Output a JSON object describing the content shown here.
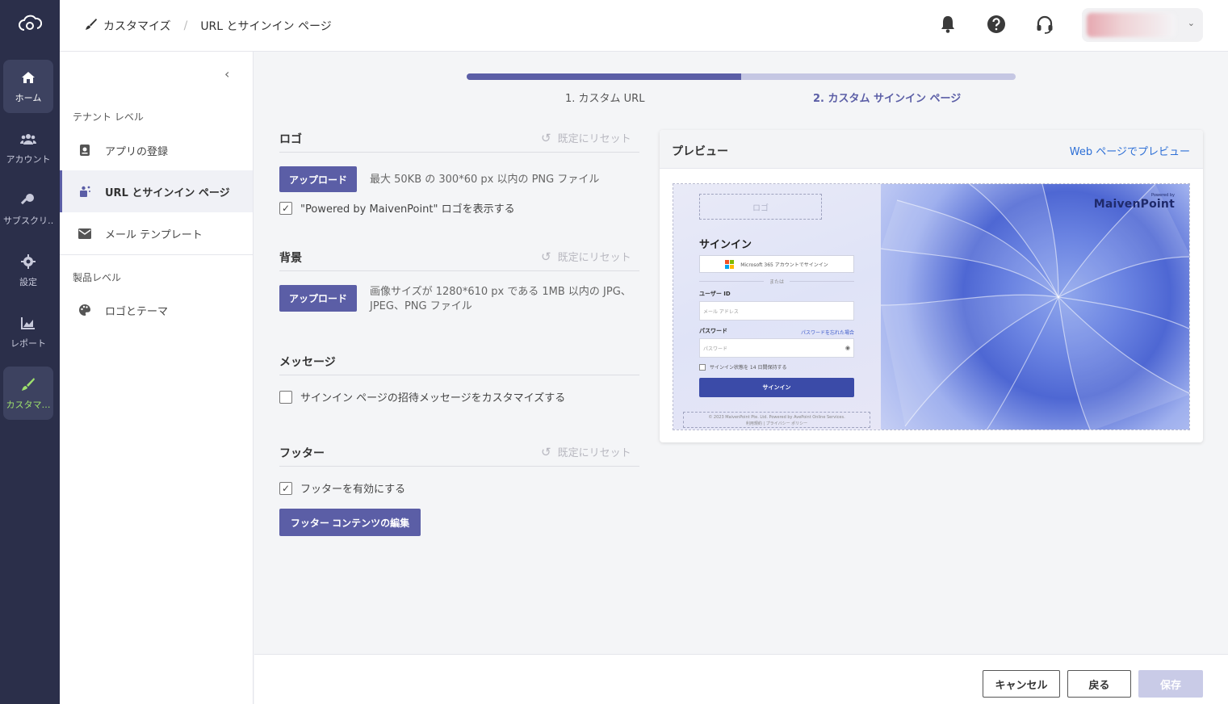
{
  "rail": {
    "items": [
      {
        "label": "ホーム",
        "icon": "home-icon"
      },
      {
        "label": "アカウント",
        "icon": "users-icon"
      },
      {
        "label": "サブスクリ…",
        "icon": "key-icon"
      },
      {
        "label": "設定",
        "icon": "gear-icon"
      },
      {
        "label": "レポート",
        "icon": "chart-icon"
      },
      {
        "label": "カスタマ…",
        "icon": "brush-icon"
      }
    ]
  },
  "header": {
    "breadcrumb_root": "カスタマイズ",
    "breadcrumb_sep": "/",
    "breadcrumb_current": "URL とサインイン ページ"
  },
  "subnav": {
    "tenant_section": "テナント レベル",
    "items": [
      {
        "label": "アプリの登録",
        "icon": "app-registration-icon"
      },
      {
        "label": "URL とサインイン ページ",
        "icon": "url-signin-icon"
      },
      {
        "label": "メール テンプレート",
        "icon": "mail-icon"
      }
    ],
    "product_section": "製品レベル",
    "product_items": [
      {
        "label": "ロゴとテーマ",
        "icon": "palette-icon"
      }
    ]
  },
  "stepper": {
    "progress": 0.5,
    "step1": "1. カスタム URL",
    "step2": "2. カスタム サインイン ページ"
  },
  "logo_section": {
    "title": "ロゴ",
    "reset": "既定にリセット",
    "upload": "アップロード",
    "hint": "最大 50KB の 300*60 px 以内の PNG ファイル",
    "powered_checkbox": "\"Powered by MaivenPoint\" ロゴを表示する",
    "powered_checked": true
  },
  "background_section": {
    "title": "背景",
    "reset": "既定にリセット",
    "upload": "アップロード",
    "hint_line1": "画像サイズが 1280*610 px である 1MB 以内の JPG、",
    "hint_line2": "JPEG、PNG ファイル"
  },
  "message_section": {
    "title": "メッセージ",
    "checkbox": "サインイン ページの招待メッセージをカスタマイズする",
    "checked": false
  },
  "footer_section": {
    "title": "フッター",
    "reset": "既定にリセット",
    "checkbox": "フッターを有効にする",
    "checked": true,
    "edit_button": "フッター コンテンツの編集"
  },
  "preview": {
    "title": "プレビュー",
    "web_link": "Web ページでプレビュー",
    "logo_placeholder": "ロゴ",
    "signin_title": "サインイン",
    "ms_button": "Microsoft 365 アカウントでサインイン",
    "or": "または",
    "user_id_label": "ユーザー ID",
    "email_placeholder": "メール アドレス",
    "password_label": "パスワード",
    "forgot": "パスワードを忘れた場合",
    "password_placeholder": "パスワード",
    "keep_signed": "サインイン状態を 14 日間保持する",
    "signin_button": "サインイン",
    "footer_line1": "© 2023 MaivenPoint Pte. Ltd. Powered by AvePoint Online Services.",
    "footer_line2": "利用規約 | プライバシー ポリシー",
    "powered_by": "Powered by",
    "brand": "MaivenPoint"
  },
  "footer_buttons": {
    "cancel": "キャンセル",
    "back": "戻る",
    "save": "保存"
  },
  "colors": {
    "accent": "#5b5ea6",
    "rail_bg": "#2b2f4a",
    "active_green": "#9ee06d",
    "link_blue": "#2d6fd6"
  }
}
